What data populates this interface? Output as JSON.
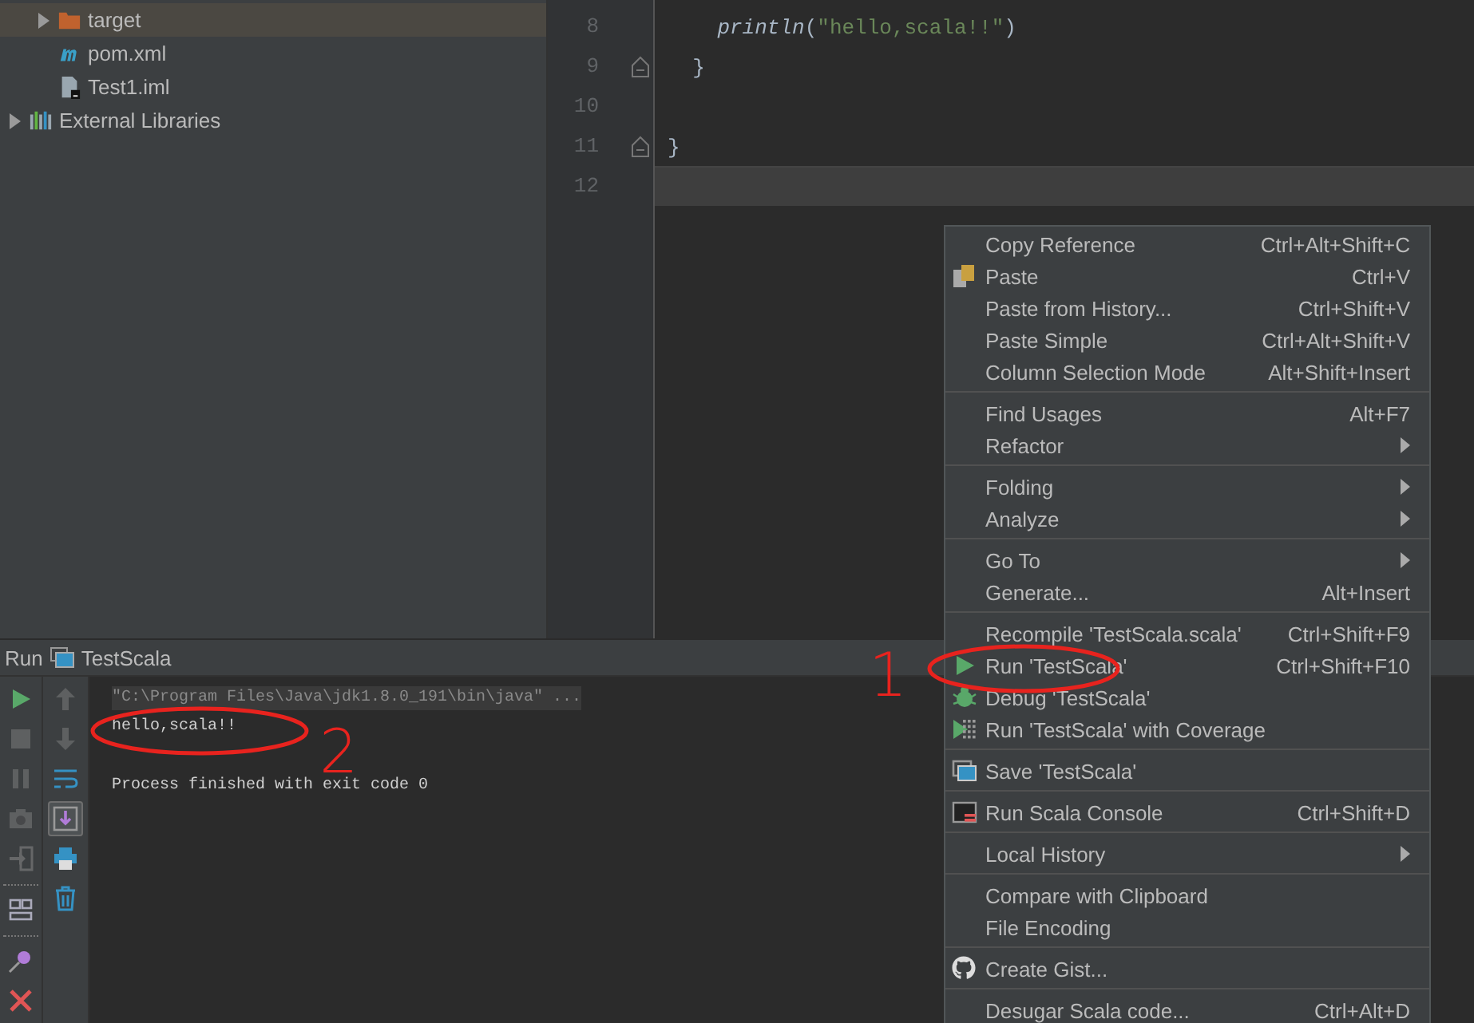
{
  "project_tree": [
    {
      "children": [
        {
          "label": "target",
          "kind": "folder",
          "expanded": false,
          "selected": true
        },
        {
          "label": "pom.xml",
          "kind": "maven",
          "selected": false
        },
        {
          "label": "Test1.iml",
          "kind": "iml",
          "selected": false
        }
      ]
    },
    {
      "label": "External Libraries",
      "kind": "libraries",
      "expanded": false,
      "selected": false
    }
  ],
  "editor": {
    "lines": [
      {
        "number": "8",
        "current": false,
        "fold": false,
        "tokens": [
          {
            "kind": "call",
            "text": "    println"
          },
          {
            "kind": "plain",
            "text": "("
          },
          {
            "kind": "string",
            "text": "\"hello,scala!!\""
          },
          {
            "kind": "plain",
            "text": ")"
          }
        ]
      },
      {
        "number": "9",
        "current": false,
        "fold": true,
        "tokens": [
          {
            "kind": "plain",
            "text": "  }"
          }
        ]
      },
      {
        "number": "10",
        "current": false,
        "fold": false
      },
      {
        "number": "11",
        "current": false,
        "fold": true,
        "tokens": [
          {
            "kind": "plain",
            "text": "}"
          }
        ]
      },
      {
        "number": "12",
        "current": true,
        "fold": false
      }
    ]
  },
  "run_panel": {
    "label": "Run",
    "config": "TestScala",
    "left_toolbar": [
      {
        "kind": "run",
        "disabled": false
      },
      {
        "kind": "stop",
        "disabled": true
      },
      {
        "kind": "pause",
        "disabled": true
      },
      {
        "kind": "dump",
        "disabled": true
      },
      {
        "kind": "exit",
        "disabled": true
      },
      {
        "kind": "separator"
      },
      {
        "kind": "layout",
        "disabled": false
      },
      {
        "kind": "separator"
      },
      {
        "kind": "pin",
        "disabled": false
      },
      {
        "kind": "close",
        "disabled": false
      }
    ],
    "console_toolbar": [
      {
        "kind": "up",
        "active": false,
        "disabled": true
      },
      {
        "kind": "down",
        "active": false,
        "disabled": true
      },
      {
        "kind": "wrap",
        "active": false,
        "disabled": false
      },
      {
        "kind": "scroll-end",
        "active": true,
        "disabled": false
      },
      {
        "kind": "print",
        "active": false,
        "disabled": false
      },
      {
        "kind": "trash",
        "active": false,
        "disabled": false
      }
    ],
    "console": [
      {
        "kind": "command",
        "text": "\"C:\\Program Files\\Java\\jdk1.8.0_191\\bin\\java\" ..."
      },
      {
        "kind": "output",
        "text": "hello,scala!!"
      },
      {
        "kind": "status",
        "text": "Process finished with exit code 0"
      }
    ]
  },
  "context_menu": {
    "groups": [
      [
        {
          "label": "Copy Reference",
          "shortcut": "Ctrl+Alt+Shift+C"
        },
        {
          "label": "Paste",
          "shortcut": "Ctrl+V",
          "kind": "paste"
        },
        {
          "label": "Paste from History...",
          "shortcut": "Ctrl+Shift+V"
        },
        {
          "label": "Paste Simple",
          "shortcut": "Ctrl+Alt+Shift+V"
        },
        {
          "label": "Column Selection Mode",
          "shortcut": "Alt+Shift+Insert"
        }
      ],
      [
        {
          "label": "Find Usages",
          "shortcut": "Alt+F7"
        },
        {
          "label": "Refactor",
          "submenu": true
        }
      ],
      [
        {
          "label": "Folding",
          "submenu": true
        },
        {
          "label": "Analyze",
          "submenu": true
        }
      ],
      [
        {
          "label": "Go To",
          "submenu": true
        },
        {
          "label": "Generate...",
          "shortcut": "Alt+Insert"
        }
      ],
      [
        {
          "label": "Recompile 'TestScala.scala'",
          "shortcut": "Ctrl+Shift+F9"
        },
        {
          "label": "Run 'TestScala'",
          "shortcut": "Ctrl+Shift+F10",
          "kind": "run"
        },
        {
          "label": "Debug 'TestScala'",
          "kind": "debug"
        },
        {
          "label": "Run 'TestScala' with Coverage",
          "kind": "coverage"
        }
      ],
      [
        {
          "label": "Save 'TestScala'",
          "kind": "save"
        }
      ],
      [
        {
          "label": "Run Scala Console",
          "shortcut": "Ctrl+Shift+D",
          "kind": "console"
        }
      ],
      [
        {
          "label": "Local History",
          "submenu": true
        }
      ],
      [
        {
          "label": "Compare with Clipboard"
        },
        {
          "label": "File Encoding"
        }
      ],
      [
        {
          "label": "Create Gist...",
          "kind": "github"
        }
      ],
      [
        {
          "label": "Desugar Scala code...",
          "shortcut": "Ctrl+Alt+D"
        }
      ]
    ]
  },
  "annotations": [
    {
      "text": "1"
    },
    {
      "text": "2"
    }
  ]
}
